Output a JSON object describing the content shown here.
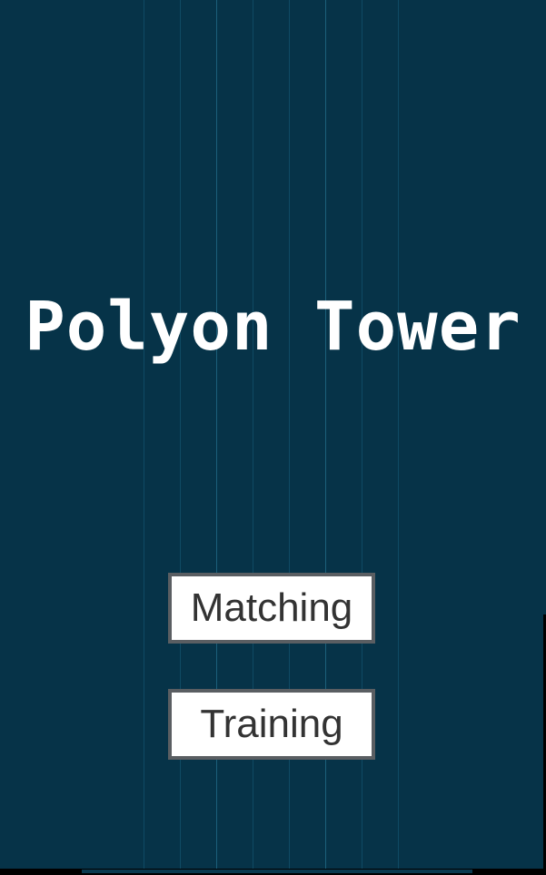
{
  "game": {
    "title": "Polyon Tower"
  },
  "menu": {
    "matching_label": "Matching",
    "training_label": "Training"
  },
  "colors": {
    "background": "#063348",
    "grid_line": "#0f4a64",
    "title_text": "#ffffff",
    "button_fill": "#ffffff",
    "button_border": "#5a5e62",
    "button_text": "#333333"
  }
}
